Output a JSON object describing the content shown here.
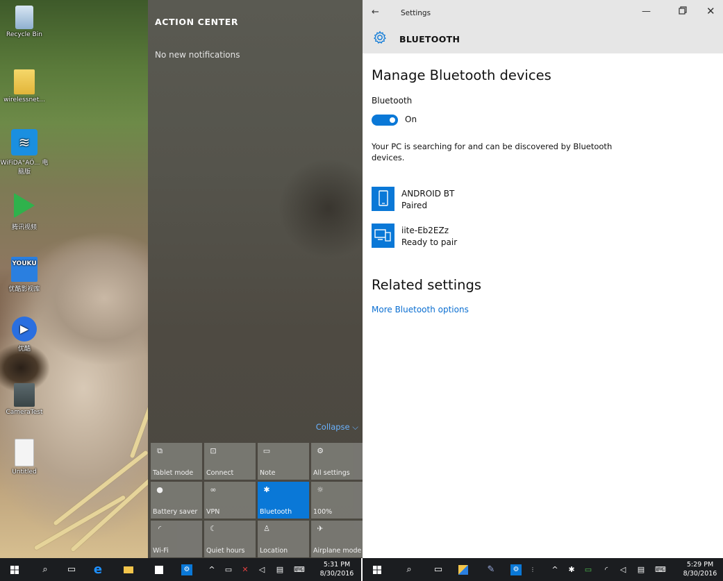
{
  "desktop": {
    "icons": [
      {
        "label": "Recycle Bin",
        "icon": "recycle-bin-icon"
      },
      {
        "label": "wirelessnet...",
        "icon": "folder-icon"
      },
      {
        "label": "WiFiDA°AÖ... 电脑版",
        "icon": "wifi-app-icon"
      },
      {
        "label": "腾讯视频",
        "icon": "video-player-icon"
      },
      {
        "label": "优酷影视库",
        "icon": "youku-icon"
      },
      {
        "label": "优酷",
        "icon": "play-icon"
      },
      {
        "label": "CameraTest",
        "icon": "camera-icon"
      },
      {
        "label": "Untitled",
        "icon": "document-icon"
      }
    ]
  },
  "action_center": {
    "title": "ACTION CENTER",
    "empty_message": "No new notifications",
    "collapse_label": "Collapse ⌵",
    "tiles": [
      {
        "label": "Tablet mode",
        "icon": "tablet-mode-icon",
        "glyph": "⧉",
        "active": false
      },
      {
        "label": "Connect",
        "icon": "connect-icon",
        "glyph": "⊡",
        "active": false
      },
      {
        "label": "Note",
        "icon": "note-icon",
        "glyph": "▭",
        "active": false
      },
      {
        "label": "All settings",
        "icon": "gear-icon",
        "glyph": "⚙",
        "active": false
      },
      {
        "label": "Battery saver",
        "icon": "battery-saver-icon",
        "glyph": "●",
        "active": false
      },
      {
        "label": "VPN",
        "icon": "vpn-icon",
        "glyph": "∞",
        "active": false
      },
      {
        "label": "Bluetooth",
        "icon": "bluetooth-icon",
        "glyph": "✱",
        "active": true
      },
      {
        "label": "100%",
        "icon": "brightness-icon",
        "glyph": "☼",
        "active": false
      },
      {
        "label": "Wi-Fi",
        "icon": "wifi-icon",
        "glyph": "◜",
        "active": false
      },
      {
        "label": "Quiet hours",
        "icon": "moon-icon",
        "glyph": "☾",
        "active": false
      },
      {
        "label": "Location",
        "icon": "location-icon",
        "glyph": "♙",
        "active": false
      },
      {
        "label": "Airplane mode",
        "icon": "airplane-icon",
        "glyph": "✈",
        "active": false
      }
    ]
  },
  "settings": {
    "window_title": "Settings",
    "back_glyph": "←",
    "minimize_glyph": "—",
    "close_glyph": "✕",
    "header_title": "BLUETOOTH",
    "section_title": "Manage Bluetooth devices",
    "bluetooth_label": "Bluetooth",
    "toggle_state": "On",
    "toggle_on": true,
    "searching_text": "Your PC is searching for and can be discovered by Bluetooth devices.",
    "devices": [
      {
        "name": "ANDROID BT",
        "status": "Paired",
        "icon": "phone-icon"
      },
      {
        "name": "iite-Eb2EZz",
        "status": "Ready to pair",
        "icon": "computer-device-icon"
      }
    ],
    "related_title": "Related settings",
    "related_link": "More Bluetooth options",
    "accent_color": "#0a78d7",
    "link_color": "#0a6ed1"
  },
  "taskbar_left": {
    "clock_time": "5:31 PM",
    "clock_date": "8/30/2016"
  },
  "taskbar_right": {
    "clock_time": "5:29 PM",
    "clock_date": "8/30/2016"
  }
}
